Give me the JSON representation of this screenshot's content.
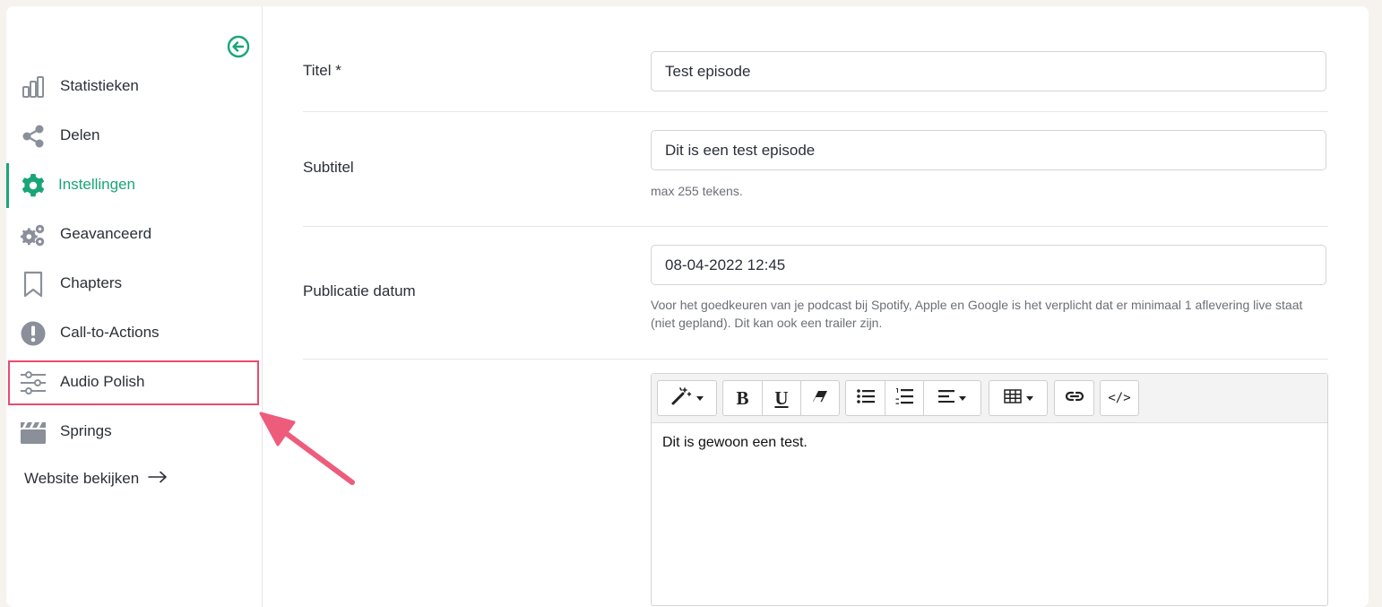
{
  "sidebar": {
    "items": [
      {
        "label": "Statistieken",
        "icon": "bar-chart-icon"
      },
      {
        "label": "Delen",
        "icon": "share-icon"
      },
      {
        "label": "Instellingen",
        "icon": "gear-icon",
        "active": true
      },
      {
        "label": "Geavanceerd",
        "icon": "gears-icon"
      },
      {
        "label": "Chapters",
        "icon": "bookmark-icon"
      },
      {
        "label": "Call-to-Actions",
        "icon": "exclamation-circle-icon"
      },
      {
        "label": "Audio Polish",
        "icon": "sliders-icon",
        "highlighted": true
      },
      {
        "label": "Springs",
        "icon": "clapperboard-icon"
      }
    ],
    "website_link": "Website bekijken"
  },
  "form": {
    "title": {
      "label": "Titel *",
      "value": "Test episode"
    },
    "subtitle": {
      "label": "Subtitel",
      "value": "Dit is een test episode",
      "hint": "max 255 tekens."
    },
    "publish_date": {
      "label": "Publicatie datum",
      "value": "08-04-2022 12:45",
      "hint": "Voor het goedkeuren van je podcast bij Spotify, Apple en Google is het verplicht dat er minimaal 1 aflevering live staat (niet gepland). Dit kan ook een trailer zijn."
    },
    "description": {
      "content": "Dit is gewoon een test."
    }
  },
  "editor_toolbar": {
    "bold": "B",
    "underline": "U",
    "code": "</>"
  },
  "colors": {
    "accent": "#1aa578",
    "highlight": "#e94b6c",
    "background": "#f6f3ee"
  }
}
